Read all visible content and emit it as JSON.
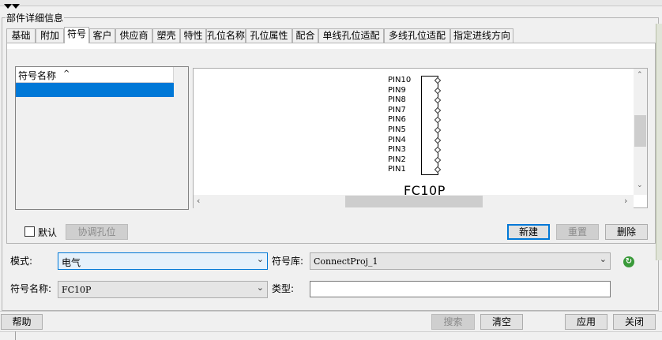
{
  "panel": {
    "title": "部件详细信息"
  },
  "tabs": [
    {
      "label": "基础"
    },
    {
      "label": "附加"
    },
    {
      "label": "符号"
    },
    {
      "label": "客户"
    },
    {
      "label": "供应商"
    },
    {
      "label": "塑壳"
    },
    {
      "label": "特性"
    },
    {
      "label": "孔位名称"
    },
    {
      "label": "孔位属性"
    },
    {
      "label": "配合"
    },
    {
      "label": "单线孔位适配"
    },
    {
      "label": "多线孔位适配"
    },
    {
      "label": "指定进线方向"
    }
  ],
  "active_tab": "符号",
  "symbol_list": {
    "header": "符号名称",
    "sort_icon": "chevron-up-icon"
  },
  "preview": {
    "pins": [
      "PIN10",
      "PIN9",
      "PIN8",
      "PIN7",
      "PIN6",
      "PIN5",
      "PIN4",
      "PIN3",
      "PIN2",
      "PIN1"
    ],
    "symbol_label": "FC10P"
  },
  "controls": {
    "default_checkbox": "默认",
    "coordinate_holes_btn": "协调孔位",
    "new_btn": "新建",
    "reset_btn": "重置",
    "delete_btn": "删除"
  },
  "form": {
    "mode_label": "模式:",
    "mode_value": "电气",
    "library_label": "符号库:",
    "library_value": "ConnectProj_1",
    "symbol_name_label": "符号名称:",
    "symbol_name_value": "FC10P",
    "type_label": "类型:",
    "type_value": ""
  },
  "footer": {
    "help_btn": "帮助",
    "search_btn": "搜索",
    "clear_btn": "清空",
    "apply_btn": "应用",
    "close_btn": "关闭"
  },
  "colors": {
    "selection": "#0078d7",
    "accent": "#0078d7",
    "refresh_icon": "#3a9a3a"
  }
}
